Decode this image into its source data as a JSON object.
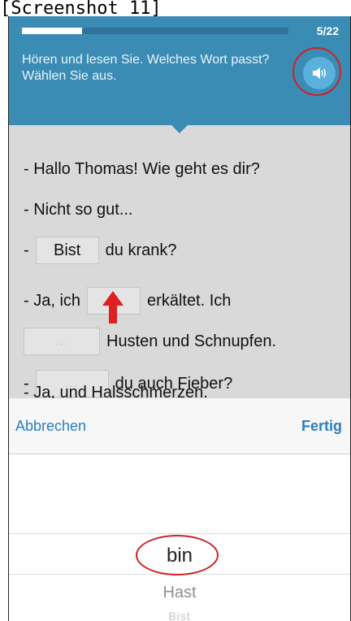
{
  "caption": "[Screenshot 11]",
  "header": {
    "progress_text": "5/22",
    "progress_fraction": 0.227,
    "instruction": "Hören und lesen Sie. Welches Wort passt? Wählen Sie aus.",
    "speaker_icon": "speaker-icon"
  },
  "dialogue": {
    "line1": "- Hallo Thomas! Wie geht es dir?",
    "line2": "- Nicht so gut...",
    "line3": {
      "prefix": "-",
      "gap": "Bist",
      "suffix": "du krank?"
    },
    "line4": {
      "prefix": "- Ja, ich",
      "gap": "...",
      "suffix": "erkältet. Ich"
    },
    "line5": {
      "gap": "...",
      "suffix": "Husten und Schnupfen."
    },
    "line6": {
      "prefix": "-",
      "gap": "...",
      "suffix": "du auch Fieber?"
    },
    "line7_partial": "- Ja, und Halsschmerzen."
  },
  "picker": {
    "cancel": "Abbrechen",
    "done": "Fertig",
    "options": [
      "bin",
      "Hast",
      "Bist"
    ]
  },
  "colors": {
    "header_bg": "#3b8cb4",
    "accent_link": "#2b7fbf",
    "annotation": "#d0202a"
  }
}
